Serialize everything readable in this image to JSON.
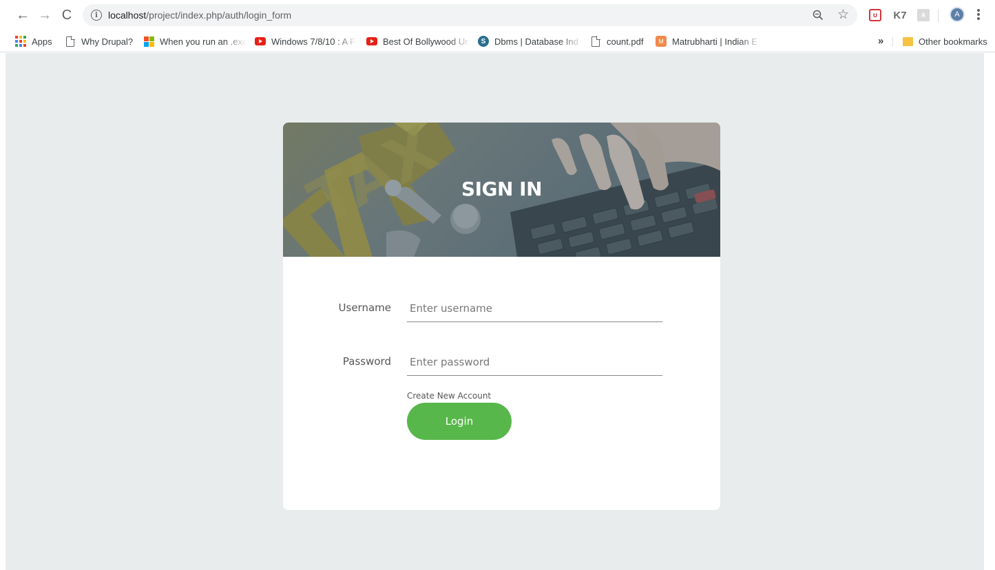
{
  "browser": {
    "url_host": "localhost",
    "url_path": "/project/index.php/auth/login_form",
    "info_glyph": "i",
    "back_glyph": "←",
    "forward_glyph": "→",
    "reload_glyph": "C",
    "star_glyph": "☆",
    "extensions": {
      "pocket": "ʊ",
      "k7": "K7",
      "pdf": "A"
    },
    "profile_initial": "A"
  },
  "bookmarks": {
    "items": [
      {
        "label": "Apps",
        "icon": "apps-grid-icon"
      },
      {
        "label": "Why Drupal?",
        "icon": "page-icon"
      },
      {
        "label": "When you run an .exe",
        "icon": "microsoft-icon"
      },
      {
        "label": "Windows 7/8/10 : A F",
        "icon": "youtube-icon"
      },
      {
        "label": "Best Of Bollywood Ur",
        "icon": "youtube-icon"
      },
      {
        "label": "Dbms | Database Ind",
        "icon": "globe-icon"
      },
      {
        "label": "count.pdf",
        "icon": "page-icon"
      },
      {
        "label": "Matrubharti | Indian E",
        "icon": "matrubharti-icon"
      }
    ],
    "overflow_glyph": "»",
    "other_label": "Other bookmarks"
  },
  "login": {
    "title": "SIGN IN",
    "username_label": "Username",
    "username_placeholder": "Enter username",
    "password_label": "Password",
    "password_placeholder": "Enter password",
    "create_account_label": "Create New Account",
    "login_button": "Login",
    "header_text": "TAX"
  },
  "colors": {
    "page_bg": "#e8ecec",
    "button_green": "#58b74a"
  }
}
